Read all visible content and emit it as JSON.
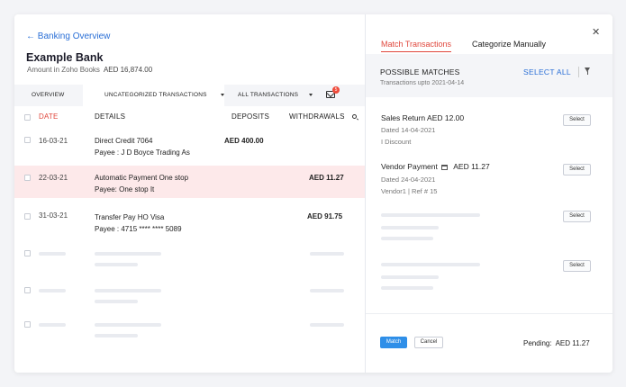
{
  "left": {
    "back_label": "Banking Overview",
    "bank_name": "Example Bank",
    "amount_label": "Amount in Zoho Books",
    "amount_value": "AED 16,874.00",
    "tabs": [
      {
        "label": "OVERVIEW"
      },
      {
        "label": "UNCATEGORIZED TRANSACTIONS"
      },
      {
        "label": "ALL TRANSACTIONS"
      }
    ],
    "mail_badge": "5",
    "columns": {
      "date": "DATE",
      "details": "DETAILS",
      "deposits": "DEPOSITS",
      "withdrawals": "WITHDRAWALS"
    },
    "rows": [
      {
        "date": "16-03-21",
        "line1": "Direct Credit 7064",
        "line2": "Payee : J D Boyce Trading As",
        "deposit": "AED 400.00",
        "withdrawal": ""
      },
      {
        "date": "22-03-21",
        "line1": "Automatic Payment One stop",
        "line2": "Payee: One stop It",
        "deposit": "",
        "withdrawal": "AED 11.27"
      },
      {
        "date": "31-03-21",
        "line1": "Transfer Pay HO Visa",
        "line2": "Payee : 4715 **** **** 5089",
        "deposit": "",
        "withdrawal": "AED 91.75"
      }
    ]
  },
  "right": {
    "tabs": [
      {
        "label": "Match Transactions"
      },
      {
        "label": "Categorize Manually"
      }
    ],
    "header_title": "POSSIBLE MATCHES",
    "header_sub": "Transactions upto 2021-04-14",
    "select_all": "SELECT ALL",
    "matches": [
      {
        "title": "Sales Return AED 12.00",
        "line2": "Dated 14-04-2021",
        "line3": "I Discount",
        "select": "Select"
      },
      {
        "title": "Vendor Payment",
        "amount": "AED 11.27",
        "line2": "Dated 24-04-2021",
        "line3": "Vendor1 | Ref # 15",
        "select": "Select"
      },
      {
        "select": "Select"
      },
      {
        "select": "Select"
      }
    ],
    "match_btn": "Match",
    "cancel_btn": "Cancel",
    "pending_label": "Pending:",
    "pending_value": "AED 11.27"
  },
  "colors": {
    "accent_red": "#e0473c",
    "link_blue": "#2a6fd6",
    "primary_btn": "#2f8fe8",
    "highlight_row": "#fde9ea"
  }
}
